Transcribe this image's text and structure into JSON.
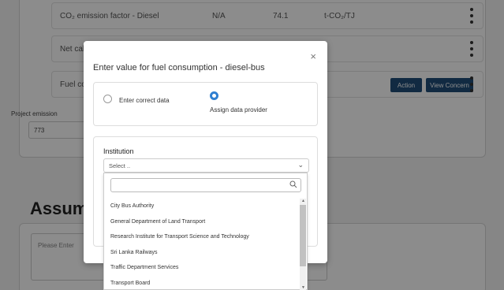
{
  "background": {
    "rows": [
      {
        "label": "CO₂ emission factor - Diesel",
        "col2": "N/A",
        "col3": "74.1",
        "col4": "t-CO₂/TJ"
      },
      {
        "label": "Net calorific",
        "col2": "",
        "col3": "",
        "col4": ""
      },
      {
        "label": "Fuel consum",
        "col2": "",
        "col3": "",
        "col4": ""
      }
    ],
    "action_label": "Action",
    "view_concern_label": "View Concern",
    "project_emission_label": "Project emission",
    "project_emission_value": "773",
    "assumptions_heading": "Assump",
    "textarea_placeholder": "Please Enter"
  },
  "modal": {
    "title": "Enter value for fuel consumption - diesel-bus",
    "close": "×",
    "radio_options": [
      {
        "label": "Enter correct data",
        "selected": false
      },
      {
        "label": "Assign data provider",
        "selected": true
      }
    ],
    "institution_label": "Institution",
    "select_value": "Select ..",
    "search_value": "",
    "dropdown_items": [
      "City Bus Authority",
      "General Department of Land Transport",
      "Research Institute for Transport Science and Technology",
      "Sri Lanka Railways",
      "Traffic Department Services",
      "Transport Board"
    ]
  },
  "colors": {
    "accent": "#2f7fd1",
    "button": "#1f4e79"
  }
}
